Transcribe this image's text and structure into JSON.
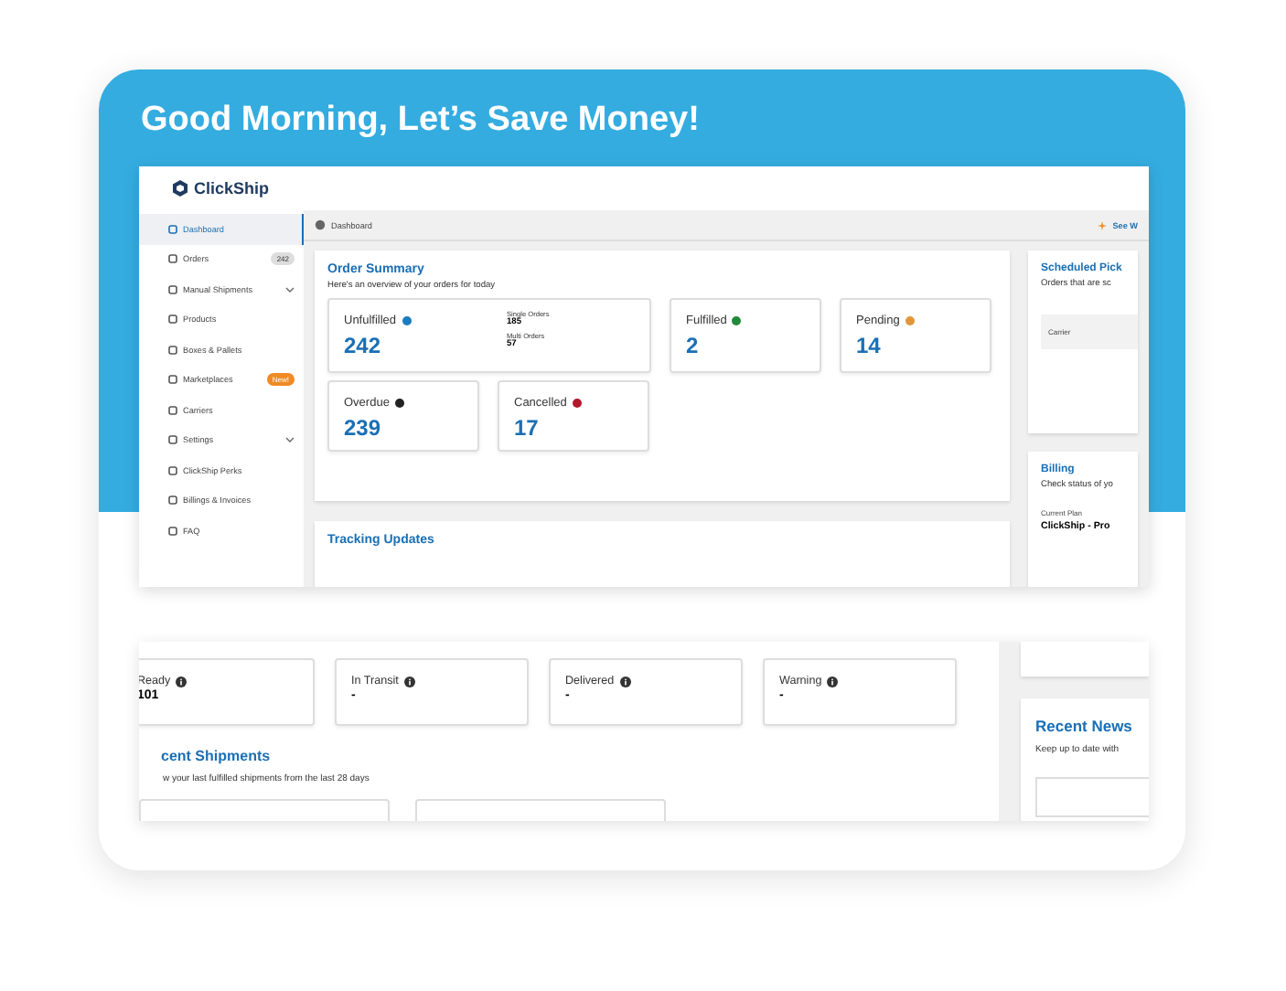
{
  "heading": "Good Morning, Let’s Save Money!",
  "app_preview": {
    "logo": "ClickShip",
    "sidebar": {
      "items": [
        {
          "label": "Dashboard",
          "selected": true
        },
        {
          "label": "Orders",
          "selected": false,
          "badge": {
            "text": "242",
            "kind": "count"
          }
        },
        {
          "label": "Manual Shipments",
          "selected": false,
          "has_submenu": true
        },
        {
          "label": "Products",
          "selected": false
        },
        {
          "label": "Boxes & Pallets",
          "selected": false
        },
        {
          "label": "Marketplaces",
          "selected": false,
          "badge": {
            "text": "New!",
            "kind": "new"
          }
        },
        {
          "label": "Carriers",
          "selected": false
        },
        {
          "label": "Settings",
          "selected": false,
          "has_submenu": true
        },
        {
          "label": "ClickShip Perks",
          "selected": false
        },
        {
          "label": "Billings & Invoices",
          "selected": false
        },
        {
          "label": "FAQ",
          "selected": false
        }
      ]
    },
    "breadcrumb": "Dashboard",
    "top_link": "See W",
    "order_summary": {
      "title": "Order Summary",
      "subtitle": "Here's an overview of your orders for today",
      "cards": [
        {
          "label": "Unfulfilled",
          "value": "242",
          "color": "#1a7bbf",
          "breakdown": [
            {
              "label": "Single Orders",
              "value": "185"
            },
            {
              "label": "Multi Orders",
              "value": "57"
            }
          ]
        },
        {
          "label": "Fulfilled",
          "value": "2",
          "color": "#1f8a3a"
        },
        {
          "label": "Pending",
          "value": "14",
          "color": "#e0963a"
        },
        {
          "label": "Overdue",
          "value": "239",
          "color": "#222222"
        },
        {
          "label": "Cancelled",
          "value": "17",
          "color": "#b3192a"
        }
      ]
    },
    "tracking": {
      "title": "Tracking Updates"
    },
    "scheduled_pickups": {
      "title": "Scheduled Pick",
      "subtitle": "Orders that are sc",
      "column": "Carrier"
    },
    "billing": {
      "title": "Billing",
      "subtitle": "Check status of yo",
      "plan_label": "Current Plan",
      "plan": "ClickShip - Pro"
    }
  },
  "tracking_preview": {
    "cards": [
      {
        "label": "Ready",
        "value": "101"
      },
      {
        "label": "In Transit",
        "value": "-"
      },
      {
        "label": "Delivered",
        "value": "-"
      },
      {
        "label": "Warning",
        "value": "-"
      }
    ],
    "recent_shipments": {
      "title": "cent Shipments",
      "subtitle": "w your last fulfilled shipments from the last 28 days"
    },
    "recent_news": {
      "title": "Recent News",
      "subtitle": "Keep up to date with"
    }
  }
}
